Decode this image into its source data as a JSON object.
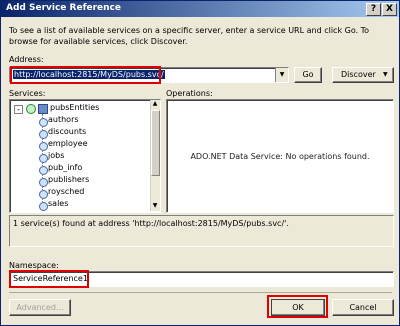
{
  "window": {
    "title": "Add Service Reference",
    "help_glyph": "?",
    "close_glyph": "X"
  },
  "description": "To see a list of available services on a specific server, enter a service URL and click Go. To browse for available services, click Discover.",
  "address": {
    "label": "Address:",
    "value": "http://localhost:2815/MyDS/pubs.svc/"
  },
  "buttons": {
    "go": "Go",
    "discover": "Discover",
    "advanced": "Advanced...",
    "ok": "OK",
    "cancel": "Cancel"
  },
  "services": {
    "label": "Services:",
    "root": "pubsEntities",
    "items": [
      "authors",
      "discounts",
      "employee",
      "jobs",
      "pub_info",
      "publishers",
      "roysched",
      "sales"
    ]
  },
  "operations": {
    "label": "Operations:",
    "message": "ADO.NET Data Service: No operations found."
  },
  "status": "1 service(s) found at address 'http://localhost:2815/MyDS/pubs.svc/'.",
  "namespace": {
    "label": "Namespace:",
    "value": "ServiceReference1"
  },
  "colors": {
    "highlight_box": "#e00000",
    "selection": "#0a246a",
    "dialog_bg": "#ece9d8"
  }
}
